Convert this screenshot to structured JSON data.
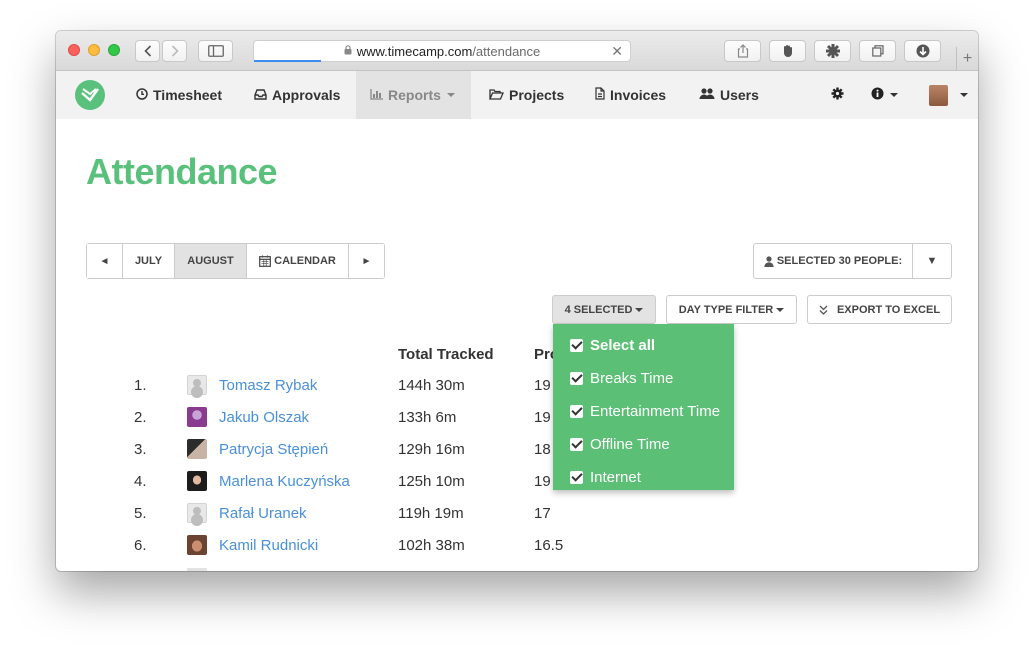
{
  "browser": {
    "url_host": "www.timecamp.com",
    "url_path": "/attendance",
    "new_tab_symbol": "+"
  },
  "nav": {
    "items": [
      {
        "label": "Timesheet",
        "icon": "clock-icon"
      },
      {
        "label": "Approvals",
        "icon": "inbox-icon"
      },
      {
        "label": "Reports",
        "icon": "bar-chart-icon",
        "active": true
      },
      {
        "label": "Projects",
        "icon": "folder-open-icon"
      },
      {
        "label": "Invoices",
        "icon": "file-icon"
      },
      {
        "label": "Users",
        "icon": "users-icon"
      }
    ]
  },
  "page": {
    "title": "Attendance"
  },
  "period": {
    "prev": "◄",
    "july": "JULY",
    "august": "AUGUST",
    "calendar": "CALENDAR",
    "next": "►"
  },
  "people": {
    "label": "SELECTED 30 PEOPLE:",
    "toggle": "▼"
  },
  "filters": {
    "selected": "4 SELECTED",
    "day_type": "DAY TYPE FILTER",
    "export": "EXPORT TO EXCEL"
  },
  "table": {
    "col_total": "Total Tracked",
    "col_pro": "Pro",
    "rows": [
      {
        "num": "1.",
        "name": "Tomasz Rybak",
        "total": "144h 30m",
        "pro": "19"
      },
      {
        "num": "2.",
        "name": "Jakub Olszak",
        "total": "133h 6m",
        "pro": "19"
      },
      {
        "num": "3.",
        "name": "Patrycja Stępień",
        "total": "129h 16m",
        "pro": "18"
      },
      {
        "num": "4.",
        "name": "Marlena Kuczyńska",
        "total": "125h 10m",
        "pro": "19"
      },
      {
        "num": "5.",
        "name": "Rafał Uranek",
        "total": "119h 19m",
        "pro": "17"
      },
      {
        "num": "6.",
        "name": "Kamil Rudnicki",
        "total": "102h 38m",
        "pro": "16.5"
      }
    ]
  },
  "dropdown": {
    "items": [
      {
        "label": "Select all",
        "checked": true
      },
      {
        "label": "Breaks Time",
        "checked": true
      },
      {
        "label": "Entertainment Time",
        "checked": true
      },
      {
        "label": "Offline Time",
        "checked": true
      },
      {
        "label": "Internet",
        "checked": true
      }
    ]
  },
  "colors": {
    "brand_green": "#5ac17c",
    "link_blue": "#4a90d9",
    "dropdown_green": "#5bbf76"
  }
}
